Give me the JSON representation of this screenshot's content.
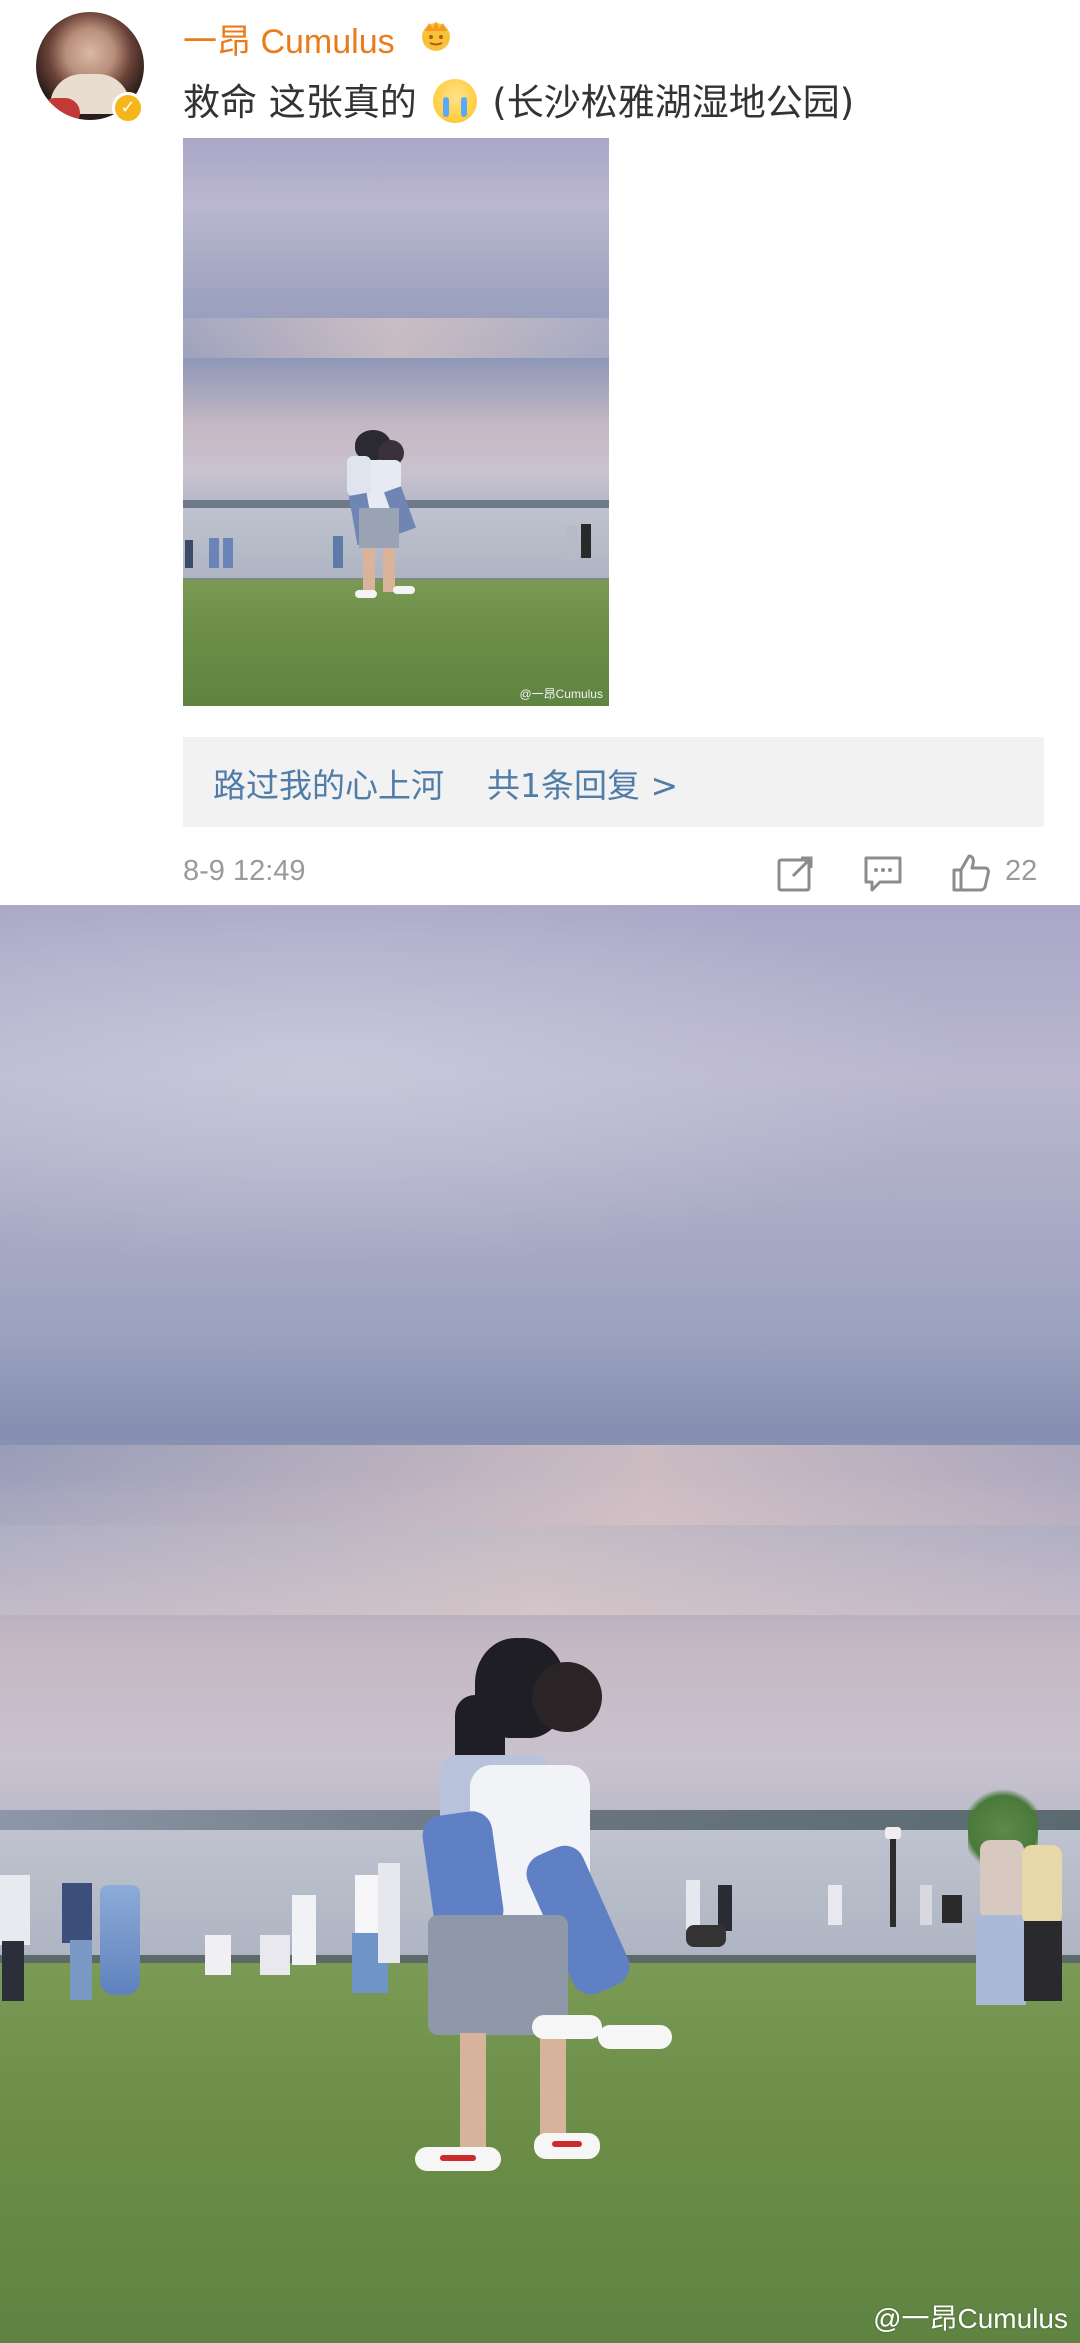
{
  "post": {
    "username": "一昂 Cumulus",
    "text_before": "救命 这张真的",
    "text_after": "(长沙松雅湖湿地公园)",
    "emoji": "crying-face-emoji",
    "verified": true,
    "photo_watermark": "@一昂Cumulus",
    "reply": {
      "preview": "路过我的心上河",
      "count_label": "共1条回复 >"
    },
    "time": "8-9 12:49",
    "actions": {
      "share_icon": "share-icon",
      "comment_icon": "comment-icon",
      "like_icon": "thumbs-up-icon",
      "like_count": "22"
    }
  },
  "big_photo": {
    "watermark": "@一昂Cumulus"
  },
  "colors": {
    "username": "#eb7a18",
    "reply_link": "#507ca8",
    "meta": "#9a9a9a",
    "reply_bg": "#f2f2f2"
  }
}
